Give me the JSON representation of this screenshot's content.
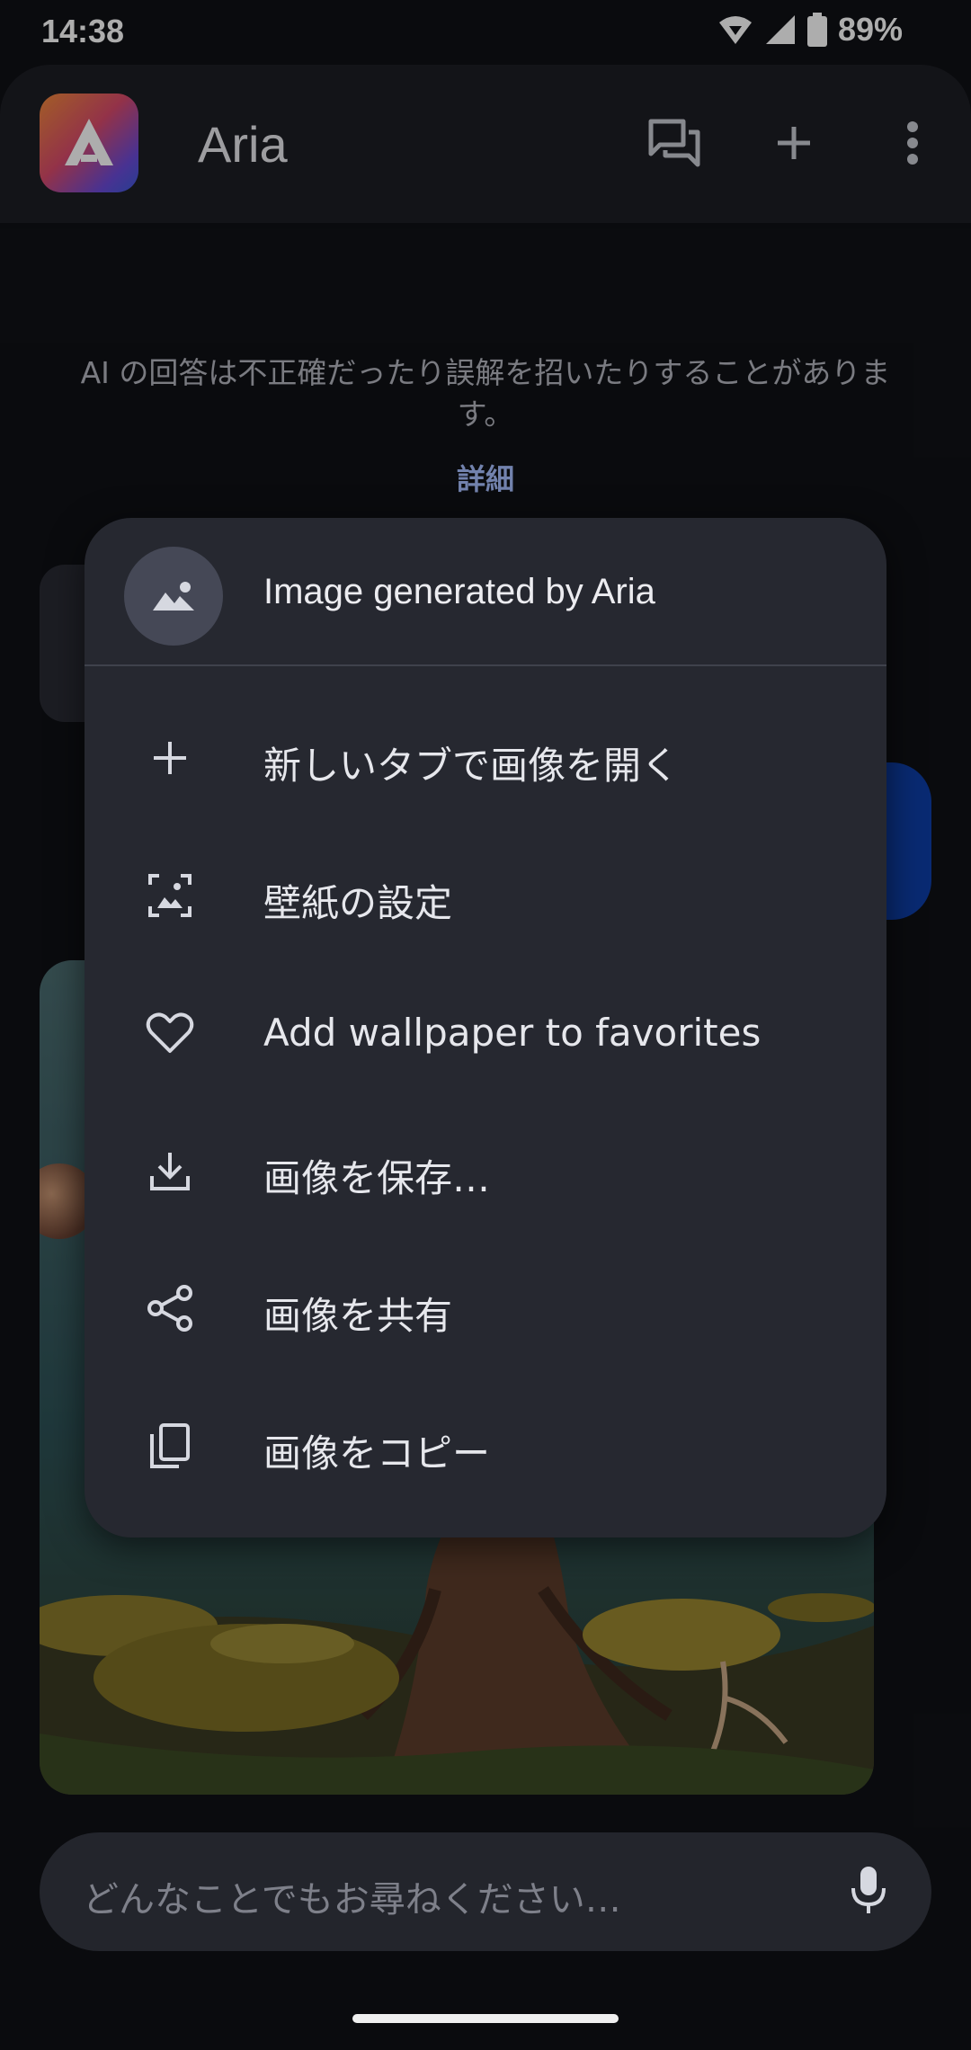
{
  "status_bar": {
    "time": "14:38",
    "battery": "89%"
  },
  "app_bar": {
    "title": "Aria",
    "actions": [
      "chat-history-icon",
      "add-icon",
      "more-vert-icon"
    ]
  },
  "disclaimer": {
    "text": "AI の回答は不正確だったり誤解を招いたりすることがあります。",
    "link": "詳細"
  },
  "context_menu": {
    "header_title": "Image generated by Aria",
    "items": [
      {
        "label": "新しいタブで画像を開く",
        "icon": "add-icon"
      },
      {
        "label": "壁紙の設定",
        "icon": "wallpaper-icon"
      },
      {
        "label": "Add wallpaper to favorites",
        "icon": "heart-icon"
      },
      {
        "label": "画像を保存…",
        "icon": "download-icon"
      },
      {
        "label": "画像を共有",
        "icon": "share-icon"
      },
      {
        "label": "画像をコピー",
        "icon": "copy-icon"
      }
    ]
  },
  "input": {
    "placeholder": "どんなことでもお尋ねください…"
  },
  "colors": {
    "accent_link": "#a8c0ff",
    "menu_bg": "#262830",
    "app_bg": "#101116",
    "user_bubble": "#0e3fa8"
  }
}
